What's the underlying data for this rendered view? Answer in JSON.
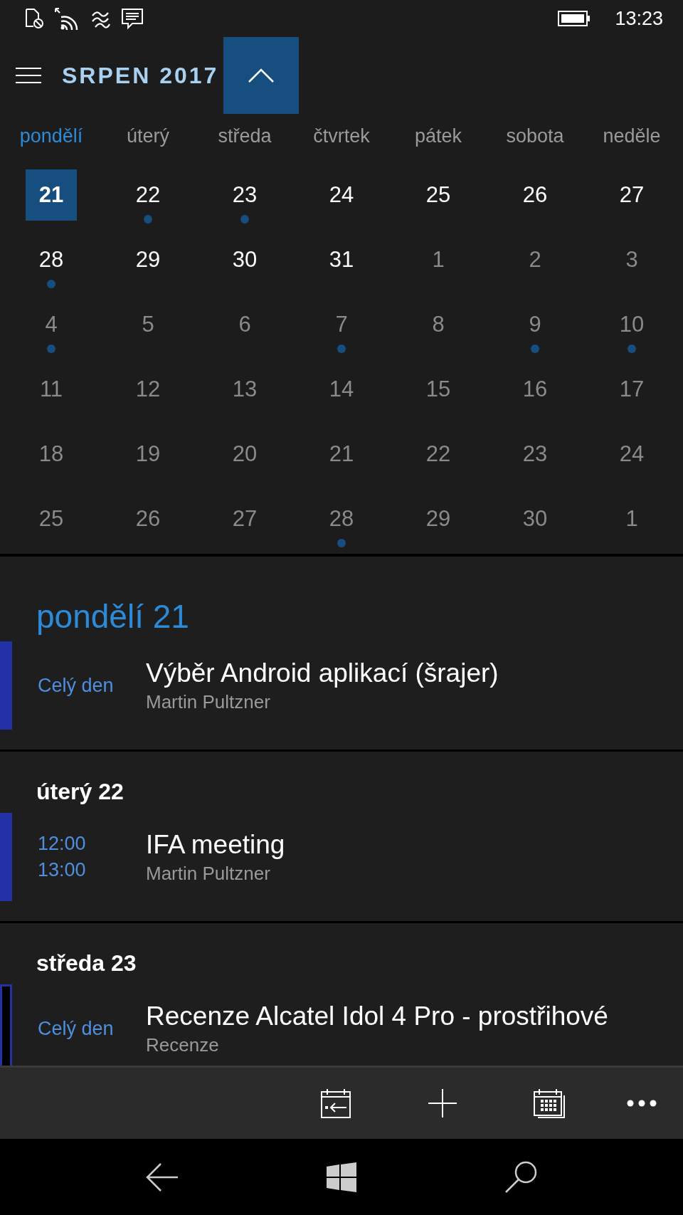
{
  "status_bar": {
    "time": "13:23"
  },
  "header": {
    "month_title": "SRPEN 2017"
  },
  "weekdays": [
    {
      "label": "pondělí",
      "selected": true
    },
    {
      "label": "úterý",
      "selected": false
    },
    {
      "label": "středa",
      "selected": false
    },
    {
      "label": "čtvrtek",
      "selected": false
    },
    {
      "label": "pátek",
      "selected": false
    },
    {
      "label": "sobota",
      "selected": false
    },
    {
      "label": "neděle",
      "selected": false
    }
  ],
  "weeks": [
    [
      {
        "label": "21",
        "current_month": true,
        "selected": true,
        "has_event": false
      },
      {
        "label": "22",
        "current_month": true,
        "selected": false,
        "has_event": true
      },
      {
        "label": "23",
        "current_month": true,
        "selected": false,
        "has_event": true
      },
      {
        "label": "24",
        "current_month": true,
        "selected": false,
        "has_event": false
      },
      {
        "label": "25",
        "current_month": true,
        "selected": false,
        "has_event": false
      },
      {
        "label": "26",
        "current_month": true,
        "selected": false,
        "has_event": false
      },
      {
        "label": "27",
        "current_month": true,
        "selected": false,
        "has_event": false
      }
    ],
    [
      {
        "label": "28",
        "current_month": true,
        "selected": false,
        "has_event": true
      },
      {
        "label": "29",
        "current_month": true,
        "selected": false,
        "has_event": false
      },
      {
        "label": "30",
        "current_month": true,
        "selected": false,
        "has_event": false
      },
      {
        "label": "31",
        "current_month": true,
        "selected": false,
        "has_event": false
      },
      {
        "label": "1",
        "current_month": false,
        "selected": false,
        "has_event": false
      },
      {
        "label": "2",
        "current_month": false,
        "selected": false,
        "has_event": false
      },
      {
        "label": "3",
        "current_month": false,
        "selected": false,
        "has_event": false
      }
    ],
    [
      {
        "label": "4",
        "current_month": false,
        "selected": false,
        "has_event": true
      },
      {
        "label": "5",
        "current_month": false,
        "selected": false,
        "has_event": false
      },
      {
        "label": "6",
        "current_month": false,
        "selected": false,
        "has_event": false
      },
      {
        "label": "7",
        "current_month": false,
        "selected": false,
        "has_event": true
      },
      {
        "label": "8",
        "current_month": false,
        "selected": false,
        "has_event": false
      },
      {
        "label": "9",
        "current_month": false,
        "selected": false,
        "has_event": true
      },
      {
        "label": "10",
        "current_month": false,
        "selected": false,
        "has_event": true
      }
    ],
    [
      {
        "label": "11",
        "current_month": false,
        "selected": false,
        "has_event": false
      },
      {
        "label": "12",
        "current_month": false,
        "selected": false,
        "has_event": false
      },
      {
        "label": "13",
        "current_month": false,
        "selected": false,
        "has_event": false
      },
      {
        "label": "14",
        "current_month": false,
        "selected": false,
        "has_event": false
      },
      {
        "label": "15",
        "current_month": false,
        "selected": false,
        "has_event": false
      },
      {
        "label": "16",
        "current_month": false,
        "selected": false,
        "has_event": false
      },
      {
        "label": "17",
        "current_month": false,
        "selected": false,
        "has_event": false
      }
    ],
    [
      {
        "label": "18",
        "current_month": false,
        "selected": false,
        "has_event": false
      },
      {
        "label": "19",
        "current_month": false,
        "selected": false,
        "has_event": false
      },
      {
        "label": "20",
        "current_month": false,
        "selected": false,
        "has_event": false
      },
      {
        "label": "21",
        "current_month": false,
        "selected": false,
        "has_event": false
      },
      {
        "label": "22",
        "current_month": false,
        "selected": false,
        "has_event": false
      },
      {
        "label": "23",
        "current_month": false,
        "selected": false,
        "has_event": false
      },
      {
        "label": "24",
        "current_month": false,
        "selected": false,
        "has_event": false
      }
    ],
    [
      {
        "label": "25",
        "current_month": false,
        "selected": false,
        "has_event": false
      },
      {
        "label": "26",
        "current_month": false,
        "selected": false,
        "has_event": false
      },
      {
        "label": "27",
        "current_month": false,
        "selected": false,
        "has_event": false
      },
      {
        "label": "28",
        "current_month": false,
        "selected": false,
        "has_event": true
      },
      {
        "label": "29",
        "current_month": false,
        "selected": false,
        "has_event": false
      },
      {
        "label": "30",
        "current_month": false,
        "selected": false,
        "has_event": false
      },
      {
        "label": "1",
        "current_month": false,
        "selected": false,
        "has_event": false
      }
    ]
  ],
  "agenda": [
    {
      "heading": "pondělí 21",
      "selected": true,
      "events": [
        {
          "time": [
            "Celý den"
          ],
          "title": "Výběr Android aplikací (šrajer)",
          "subtitle": "Martin Pultzner",
          "tentative": false
        }
      ]
    },
    {
      "heading": "úterý 22",
      "selected": false,
      "events": [
        {
          "time": [
            "12:00",
            "13:00"
          ],
          "title": "IFA meeting",
          "subtitle": "Martin Pultzner",
          "tentative": false
        }
      ]
    },
    {
      "heading": "středa 23",
      "selected": false,
      "events": [
        {
          "time": [
            "Celý den"
          ],
          "title": "Recenze Alcatel Idol 4 Pro - prostřihové",
          "subtitle": "Recenze",
          "tentative": true
        }
      ]
    }
  ]
}
